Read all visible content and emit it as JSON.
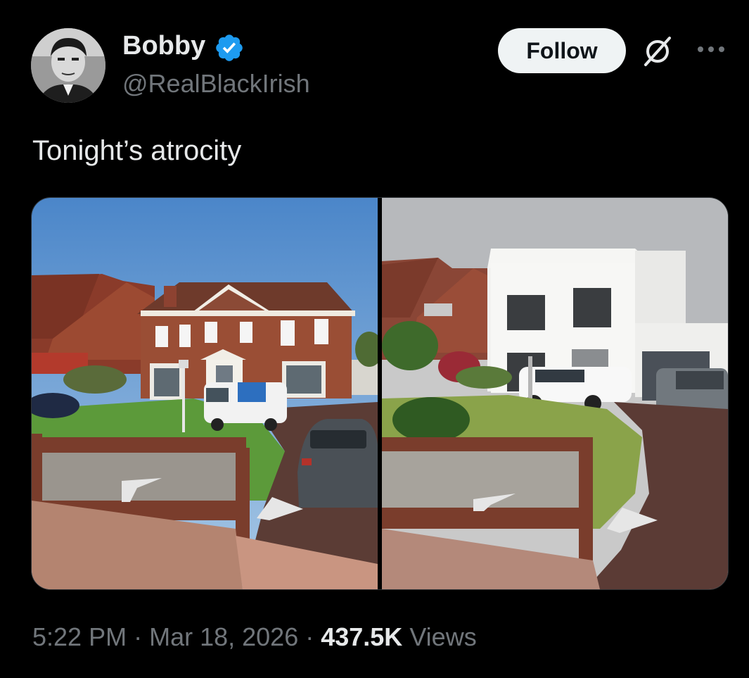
{
  "author": {
    "display_name": "Bobby",
    "handle": "@RealBlackIrish",
    "verified": true
  },
  "actions": {
    "follow_label": "Follow"
  },
  "icons": {
    "verified": "verified-badge-icon",
    "grok": "grok-icon",
    "more": "more-options-icon"
  },
  "tweet": {
    "text": "Tonight’s atrocity"
  },
  "meta": {
    "time": "5:22 PM",
    "sep1": " · ",
    "date": "Mar 18, 2026",
    "sep2": " · ",
    "views_count": "437.5K",
    "views_label": " Views"
  },
  "colors": {
    "background": "#000000",
    "text": "#e7e9ea",
    "secondary_text": "#71767b",
    "verified_blue": "#1d9bf0",
    "follow_bg": "#eff3f4"
  }
}
